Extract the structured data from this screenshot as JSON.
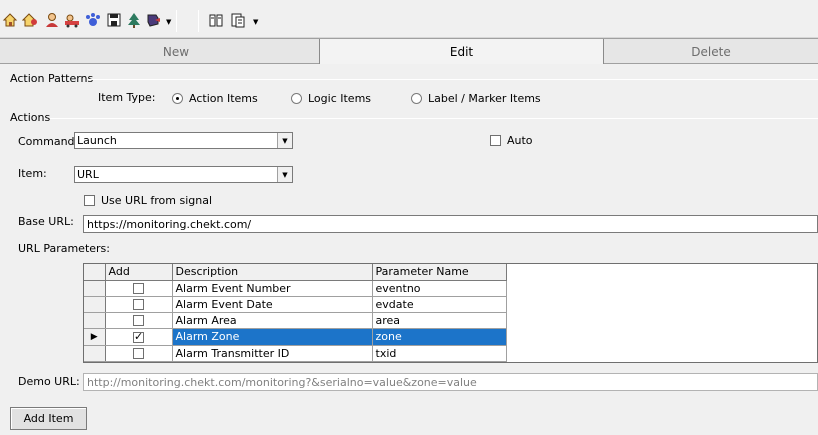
{
  "toolbar": {
    "icons": [
      "home-icon",
      "home-person-icon",
      "person-icon",
      "car-icon",
      "paw-icon",
      "floppy-disk-icon",
      "tree-icon",
      "shield-icon",
      "book-icon",
      "document-icon"
    ]
  },
  "strip": {
    "new_label": "New",
    "edit_label": "Edit",
    "delete_label": "Delete"
  },
  "action_patterns": {
    "title": "Action Patterns",
    "item_type_label": "Item Type:",
    "options": [
      "Action Items",
      "Logic Items",
      "Label / Marker Items"
    ],
    "selected": "Action Items"
  },
  "actions": {
    "title": "Actions",
    "command_label": "Command:",
    "command_value": "Launch",
    "auto_label": "Auto",
    "item_label": "Item:",
    "item_value": "URL",
    "use_url_label": "Use URL from signal",
    "base_url_label": "Base URL:",
    "base_url_value": "https://monitoring.chekt.com/",
    "url_params_label": "URL Parameters:",
    "demo_url_label": "Demo URL:",
    "demo_url_value": "http://monitoring.chekt.com/monitoring?&serialno=value&zone=value",
    "add_item_label": "Add Item"
  },
  "grid": {
    "columns": [
      "Add",
      "Description",
      "Parameter Name"
    ],
    "rows": [
      {
        "add": false,
        "description": "Alarm Event Number",
        "param": "eventno",
        "selected": false
      },
      {
        "add": false,
        "description": "Alarm Event Date",
        "param": "evdate",
        "selected": false
      },
      {
        "add": false,
        "description": "Alarm Area",
        "param": "area",
        "selected": false
      },
      {
        "add": true,
        "description": "Alarm Zone",
        "param": "zone",
        "selected": true
      },
      {
        "add": false,
        "description": "Alarm Transmitter ID",
        "param": "txid",
        "selected": false
      }
    ]
  },
  "colors": {
    "selection": "#1c74c9"
  }
}
